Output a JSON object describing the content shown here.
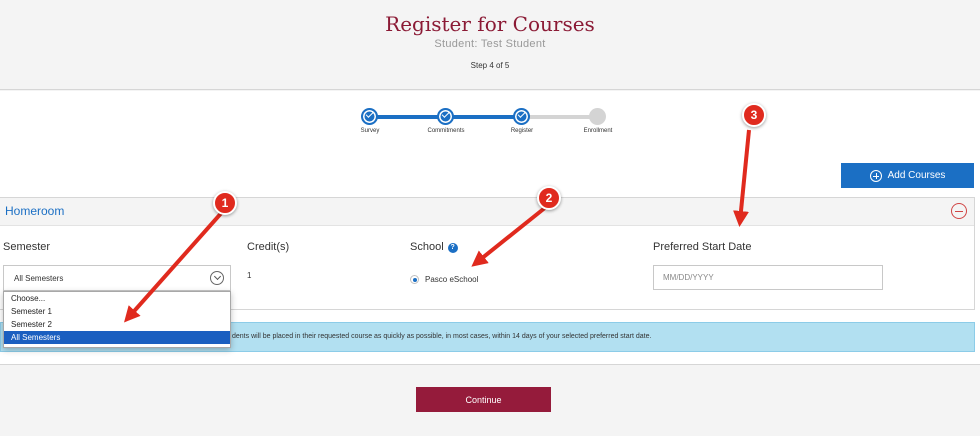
{
  "header": {
    "title": "Register for Courses",
    "student": "Student: Test Student",
    "step": "Step 4 of 5"
  },
  "progress": {
    "steps": [
      {
        "label": "Survey",
        "status": "done"
      },
      {
        "label": "Commitments",
        "status": "done"
      },
      {
        "label": "Register",
        "status": "done"
      },
      {
        "label": "Enrollment",
        "status": "todo"
      }
    ]
  },
  "toolbar": {
    "add_courses_label": "Add Courses"
  },
  "course": {
    "title": "Homeroom",
    "columns": {
      "semester": "Semester",
      "credits": "Credit(s)",
      "school": "School",
      "start_date": "Preferred Start Date"
    },
    "semester_value": "All Semesters",
    "semester_options": [
      "Choose...",
      "Semester 1",
      "Semester 2",
      "All Semesters"
    ],
    "credits_value": "1",
    "school_value": "Pasco eSchool",
    "start_date_placeholder": "MM/DD/YYYY"
  },
  "notice": "dents will be placed in their requested course as quickly as possible, in most cases, within 14 days of your selected preferred start date.",
  "continue_label": "Continue",
  "annotations": [
    "1",
    "2",
    "3"
  ],
  "colors": {
    "title": "#8b1a35",
    "primary": "#1b6fc4",
    "continue": "#951b3b",
    "notice_bg": "#b2e0f1",
    "annotation": "#e02a1e"
  }
}
